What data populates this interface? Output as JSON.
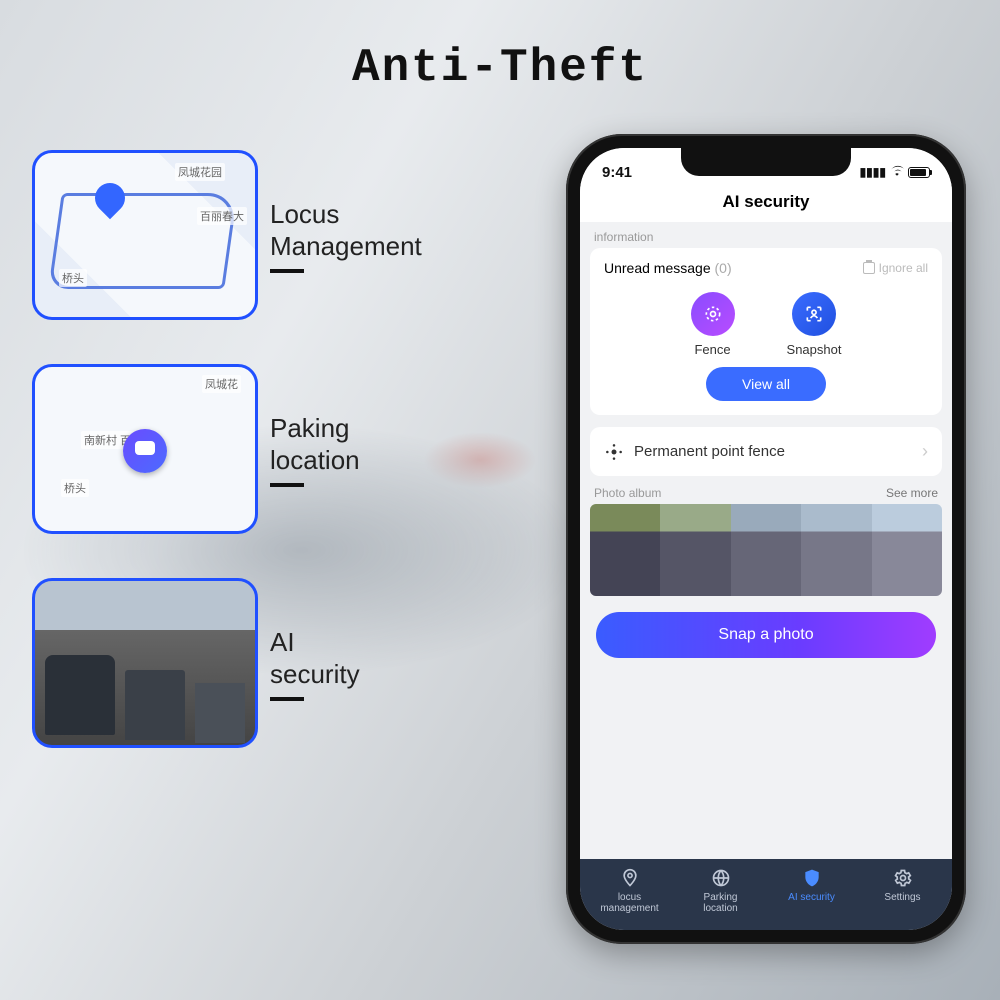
{
  "page": {
    "title": "Anti-Theft"
  },
  "features": [
    {
      "line1": "Locus",
      "line2": "Management",
      "map_text_top": "凤城花园",
      "map_text_mid": "百丽春大",
      "map_text_bot": "桥头"
    },
    {
      "line1": "Paking",
      "line2": "location",
      "map_text_top": "凤城花",
      "map_text_mid": "南新村  百丽",
      "map_text_bot": "桥头"
    },
    {
      "line1": "AI",
      "line2": "security"
    }
  ],
  "phone": {
    "status": {
      "time": "9:41"
    },
    "header": "AI security",
    "info_label": "information",
    "unread": {
      "label": "Unread message",
      "count": "(0)",
      "ignore": "Ignore all"
    },
    "buttons": {
      "fence": "Fence",
      "snapshot": "Snapshot",
      "view_all": "View all"
    },
    "permanent_fence": "Permanent point fence",
    "album": {
      "label": "Photo album",
      "more": "See more"
    },
    "snap": "Snap a photo",
    "tabs": [
      {
        "l1": "locus",
        "l2": "management"
      },
      {
        "l1": "Parking",
        "l2": "location"
      },
      {
        "l1": "AI security",
        "l2": ""
      },
      {
        "l1": "Settings",
        "l2": ""
      }
    ]
  }
}
